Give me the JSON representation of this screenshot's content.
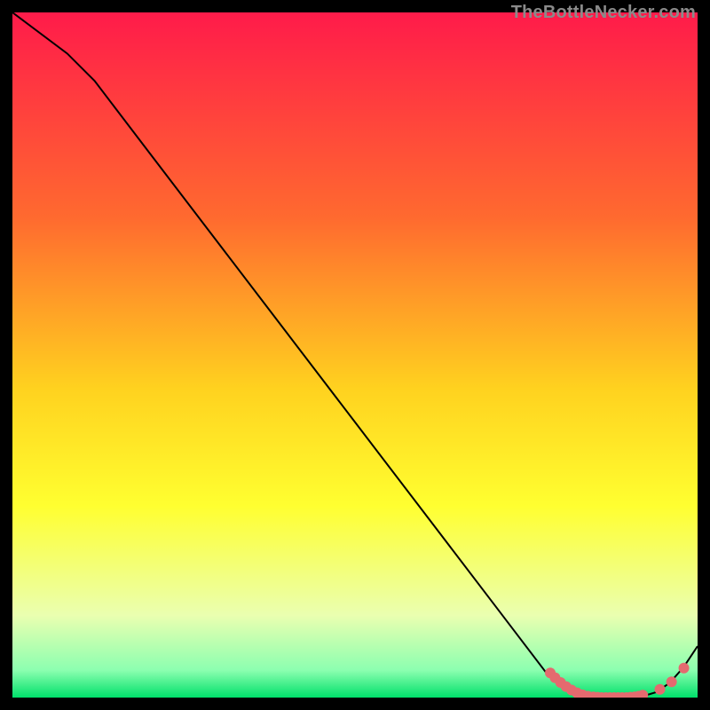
{
  "watermark": "TheBottleNecker.com",
  "colors": {
    "top": "#ff1b4a",
    "mid1": "#ff6a2f",
    "mid2": "#ffd21f",
    "mid3": "#ffff30",
    "low": "#eaffb0",
    "bottom_light": "#8cffb0",
    "bottom": "#00e06a",
    "line": "#000000",
    "marker": "#e46a6f"
  },
  "chart_data": {
    "type": "line",
    "title": "",
    "xlabel": "",
    "ylabel": "",
    "xlim": [
      0,
      100
    ],
    "ylim": [
      0,
      100
    ],
    "series": [
      {
        "name": "curve",
        "x": [
          0,
          8,
          12,
          20,
          30,
          40,
          50,
          60,
          70,
          78,
          80,
          82,
          84,
          86,
          88,
          90,
          92,
          94,
          96,
          98,
          100
        ],
        "y": [
          100,
          94,
          90,
          79.5,
          66.4,
          53.3,
          40.2,
          27.1,
          14,
          3.5,
          1.6,
          0.6,
          0.2,
          0,
          0,
          0,
          0.2,
          0.8,
          2.2,
          4.5,
          7.5
        ]
      }
    ],
    "markers": [
      {
        "x": 78.5,
        "y": 3.6
      },
      {
        "x": 79.2,
        "y": 2.9
      },
      {
        "x": 80.0,
        "y": 2.2
      },
      {
        "x": 80.8,
        "y": 1.6
      },
      {
        "x": 81.6,
        "y": 1.1
      },
      {
        "x": 82.4,
        "y": 0.7
      },
      {
        "x": 83.2,
        "y": 0.4
      },
      {
        "x": 84.0,
        "y": 0.2
      },
      {
        "x": 84.8,
        "y": 0.1
      },
      {
        "x": 85.4,
        "y": 0.05
      },
      {
        "x": 86.0,
        "y": 0.0
      },
      {
        "x": 86.6,
        "y": 0.0
      },
      {
        "x": 87.2,
        "y": 0.0
      },
      {
        "x": 87.8,
        "y": 0.0
      },
      {
        "x": 88.4,
        "y": 0.0
      },
      {
        "x": 89.0,
        "y": 0.0
      },
      {
        "x": 89.6,
        "y": 0.0
      },
      {
        "x": 90.2,
        "y": 0.05
      },
      {
        "x": 90.8,
        "y": 0.1
      },
      {
        "x": 91.4,
        "y": 0.2
      },
      {
        "x": 92.0,
        "y": 0.35
      },
      {
        "x": 94.5,
        "y": 1.2
      },
      {
        "x": 96.2,
        "y": 2.3
      },
      {
        "x": 98.0,
        "y": 4.3
      }
    ],
    "gradient_stops": [
      {
        "offset": 0.0,
        "key": "top"
      },
      {
        "offset": 0.3,
        "key": "mid1"
      },
      {
        "offset": 0.55,
        "key": "mid2"
      },
      {
        "offset": 0.72,
        "key": "mid3"
      },
      {
        "offset": 0.88,
        "key": "low"
      },
      {
        "offset": 0.96,
        "key": "bottom_light"
      },
      {
        "offset": 1.0,
        "key": "bottom"
      }
    ]
  }
}
